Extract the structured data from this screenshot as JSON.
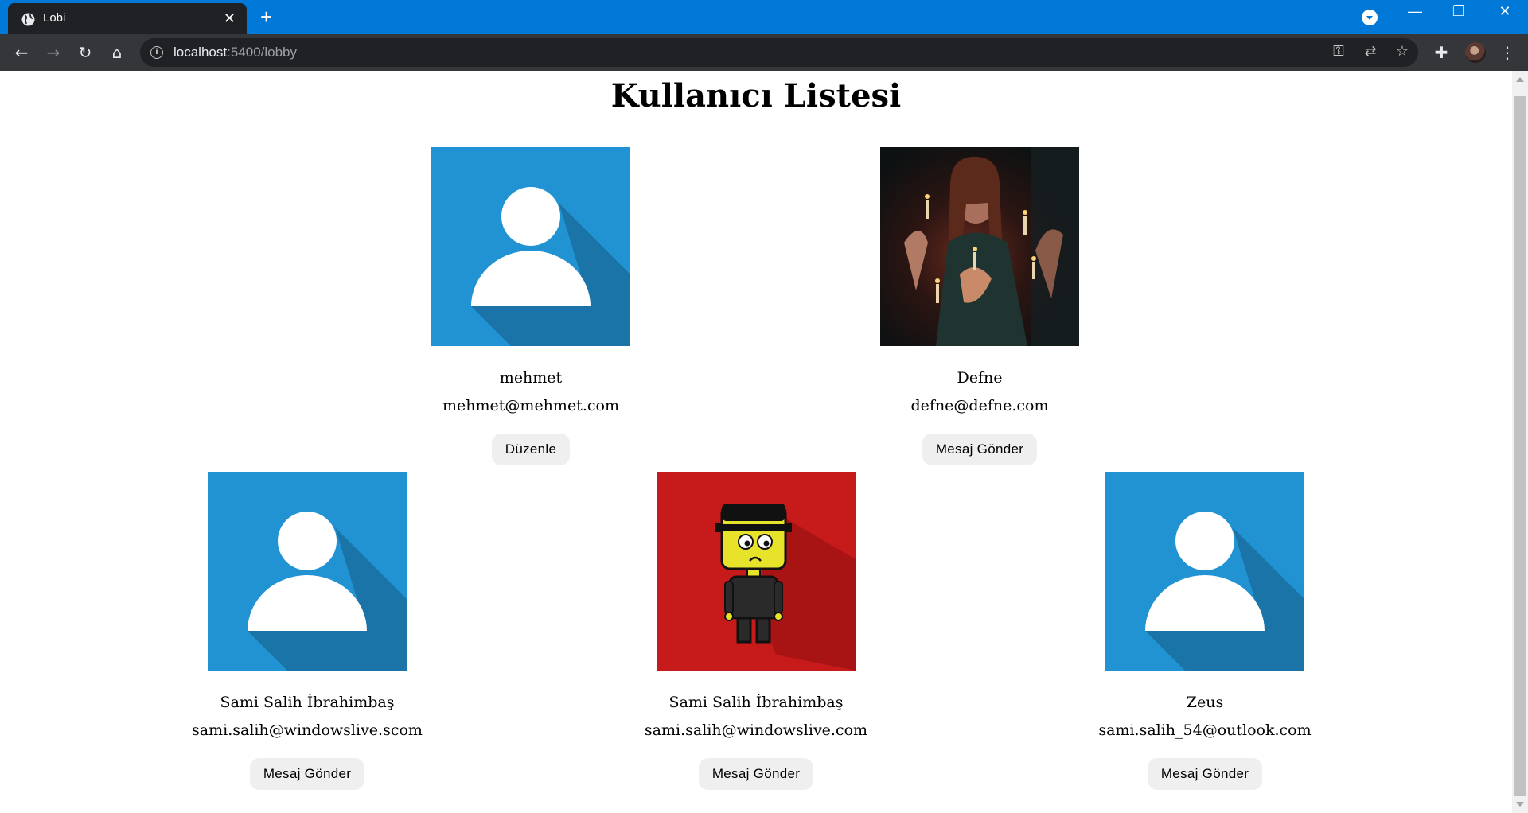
{
  "browser": {
    "tab_title": "Lobi",
    "tab_close": "✕",
    "new_tab": "+",
    "url_host": "localhost",
    "url_path": ":5400/lobby",
    "window_controls": {
      "minimize": "—",
      "restore": "❐",
      "close": "✕"
    }
  },
  "page": {
    "title": "Kullanıcı Listesi"
  },
  "users": [
    {
      "name": "mehmet",
      "email": "mehmet@mehmet.com",
      "button": "Düzenle",
      "avatar": "default-user-icon"
    },
    {
      "name": "Defne",
      "email": "defne@defne.com",
      "button": "Mesaj Gönder",
      "avatar": "candles-photo"
    },
    {
      "name": "Sami Salih İbrahimbaş",
      "email": "sami.salih@windowslive.scom",
      "button": "Mesaj Gönder",
      "avatar": "default-user-icon"
    },
    {
      "name": "Sami Salih İbrahimbaş",
      "email": "sami.salih@windowslive.com",
      "button": "Mesaj Gönder",
      "avatar": "frankenstein-cartoon"
    },
    {
      "name": "Zeus",
      "email": "sami.salih_54@outlook.com",
      "button": "Mesaj Gönder",
      "avatar": "default-user-icon"
    }
  ],
  "colors": {
    "tabbar": "#0078d7",
    "toolbar": "#35363a",
    "default_avatar_bg": "#2193d3",
    "default_avatar_shadow": "#1b74a8",
    "frank_bg": "#c71a1a",
    "button_bg": "#efefef"
  }
}
